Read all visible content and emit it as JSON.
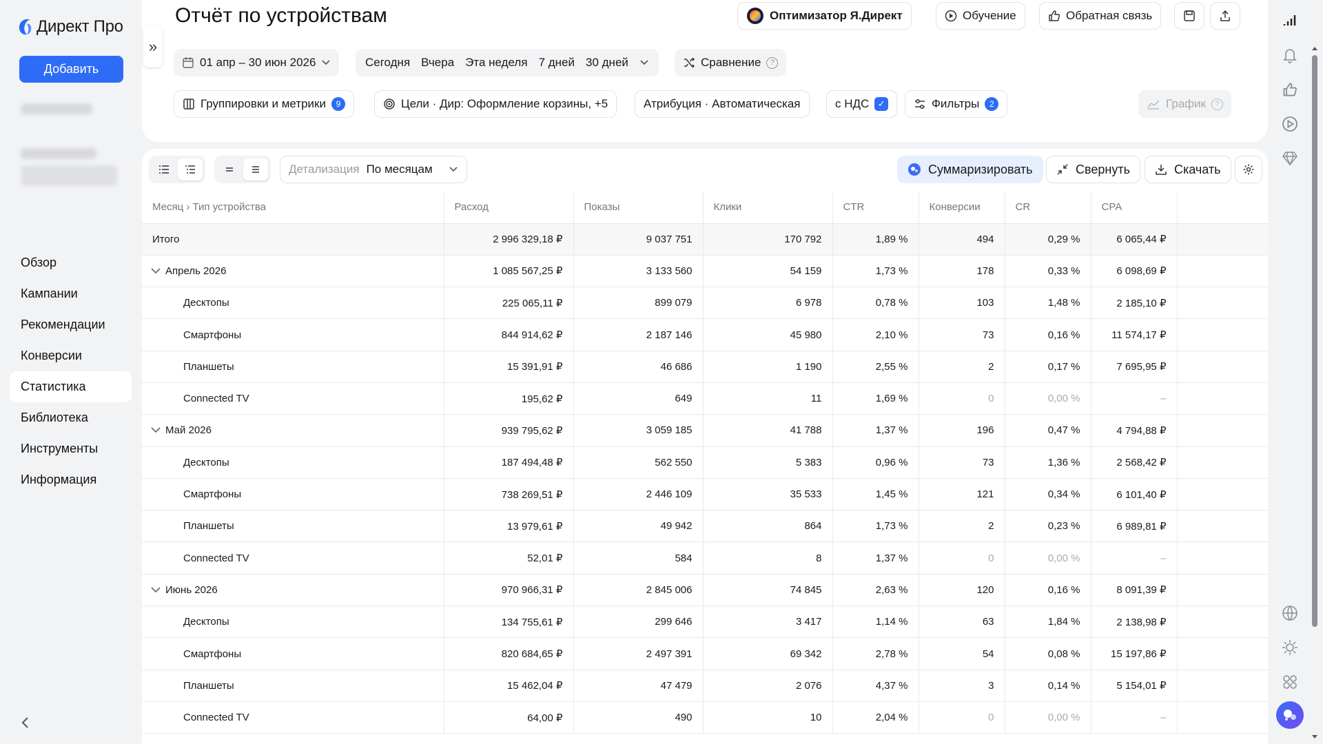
{
  "app": {
    "logo": "Директ Про",
    "add_button": "Добавить"
  },
  "nav": [
    "Обзор",
    "Кампании",
    "Рекомендации",
    "Конверсии",
    "Статистика",
    "Библиотека",
    "Инструменты",
    "Информация"
  ],
  "page": {
    "title": "Отчёт по устройствам"
  },
  "header_buttons": {
    "optimizer": "Оптимизатор Я.Директ",
    "learning": "Обучение",
    "feedback": "Обратная связь"
  },
  "period": {
    "range": "01 апр – 30 июн 2026",
    "presets": [
      "Сегодня",
      "Вчера",
      "Эта неделя",
      "7 дней",
      "30 дней"
    ],
    "compare": "Сравнение"
  },
  "filters": {
    "grouping": "Группировки и метрики",
    "grouping_count": "9",
    "goals": "Цели · Дир: Оформление корзины, +5",
    "attribution": "Атрибуция · Автоматическая",
    "vat": "с НДС",
    "filters": "Фильтры",
    "filters_count": "2",
    "chart": "График"
  },
  "table_toolbar": {
    "detail_label": "Детализация",
    "detail_value": "По месяцам",
    "summarize": "Суммаризировать",
    "collapse": "Свернуть",
    "download": "Скачать"
  },
  "columns": [
    "Месяц › Тип устройства",
    "Расход",
    "Показы",
    "Клики",
    "CTR",
    "Конверсии",
    "CR",
    "CPA"
  ],
  "rows": [
    {
      "type": "total",
      "cells": [
        "Итого",
        "2 996 329,18 ₽",
        "9 037 751",
        "170 792",
        "1,89 %",
        "494",
        "0,29 %",
        "6 065,44 ₽"
      ]
    },
    {
      "type": "group",
      "cells": [
        "Апрель 2026",
        "1 085 567,25 ₽",
        "3 133 560",
        "54 159",
        "1,73 %",
        "178",
        "0,33 %",
        "6 098,69 ₽"
      ]
    },
    {
      "type": "child",
      "cells": [
        "Десктопы",
        "225 065,11 ₽",
        "899 079",
        "6 978",
        "0,78 %",
        "103",
        "1,48 %",
        "2 185,10 ₽"
      ]
    },
    {
      "type": "child",
      "cells": [
        "Смартфоны",
        "844 914,62 ₽",
        "2 187 146",
        "45 980",
        "2,10 %",
        "73",
        "0,16 %",
        "11 574,17 ₽"
      ]
    },
    {
      "type": "child",
      "cells": [
        "Планшеты",
        "15 391,91 ₽",
        "46 686",
        "1 190",
        "2,55 %",
        "2",
        "0,17 %",
        "7 695,95 ₽"
      ]
    },
    {
      "type": "child",
      "grey": true,
      "cells": [
        "Connected TV",
        "195,62 ₽",
        "649",
        "11",
        "1,69 %",
        "0",
        "0,00 %",
        "–"
      ]
    },
    {
      "type": "group",
      "cells": [
        "Май 2026",
        "939 795,62 ₽",
        "3 059 185",
        "41 788",
        "1,37 %",
        "196",
        "0,47 %",
        "4 794,88 ₽"
      ]
    },
    {
      "type": "child",
      "cells": [
        "Десктопы",
        "187 494,48 ₽",
        "562 550",
        "5 383",
        "0,96 %",
        "73",
        "1,36 %",
        "2 568,42 ₽"
      ]
    },
    {
      "type": "child",
      "cells": [
        "Смартфоны",
        "738 269,51 ₽",
        "2 446 109",
        "35 533",
        "1,45 %",
        "121",
        "0,34 %",
        "6 101,40 ₽"
      ]
    },
    {
      "type": "child",
      "cells": [
        "Планшеты",
        "13 979,61 ₽",
        "49 942",
        "864",
        "1,73 %",
        "2",
        "0,23 %",
        "6 989,81 ₽"
      ]
    },
    {
      "type": "child",
      "grey": true,
      "cells": [
        "Connected TV",
        "52,01 ₽",
        "584",
        "8",
        "1,37 %",
        "0",
        "0,00 %",
        "–"
      ]
    },
    {
      "type": "group",
      "cells": [
        "Июнь 2026",
        "970 966,31 ₽",
        "2 845 006",
        "74 845",
        "2,63 %",
        "120",
        "0,16 %",
        "8 091,39 ₽"
      ]
    },
    {
      "type": "child",
      "cells": [
        "Десктопы",
        "134 755,61 ₽",
        "299 646",
        "3 417",
        "1,14 %",
        "63",
        "1,84 %",
        "2 138,98 ₽"
      ]
    },
    {
      "type": "child",
      "cells": [
        "Смартфоны",
        "820 684,65 ₽",
        "2 497 391",
        "69 342",
        "2,78 %",
        "54",
        "0,08 %",
        "15 197,86 ₽"
      ]
    },
    {
      "type": "child",
      "cells": [
        "Планшеты",
        "15 462,04 ₽",
        "47 479",
        "2 076",
        "4,37 %",
        "3",
        "0,14 %",
        "5 154,01 ₽"
      ]
    },
    {
      "type": "child",
      "grey": true,
      "cells": [
        "Connected TV",
        "64,00 ₽",
        "490",
        "10",
        "2,04 %",
        "0",
        "0,00 %",
        "–"
      ]
    }
  ],
  "colors": {
    "accent": "#2d6cf6",
    "background": "#f2f3f5"
  }
}
